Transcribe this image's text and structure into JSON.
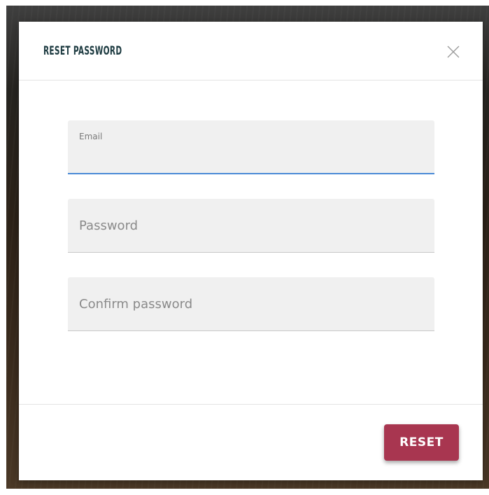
{
  "modal": {
    "title": "RESET PASSWORD",
    "close_icon": "close-icon"
  },
  "form": {
    "email": {
      "label": "Email",
      "value": ""
    },
    "password": {
      "placeholder": "Password",
      "value": ""
    },
    "confirm_password": {
      "placeholder": "Confirm password",
      "value": ""
    }
  },
  "footer": {
    "reset_label": "RESET"
  },
  "colors": {
    "title": "#1c3a40",
    "accent": "#4a8ad6",
    "button": "#a83650"
  }
}
